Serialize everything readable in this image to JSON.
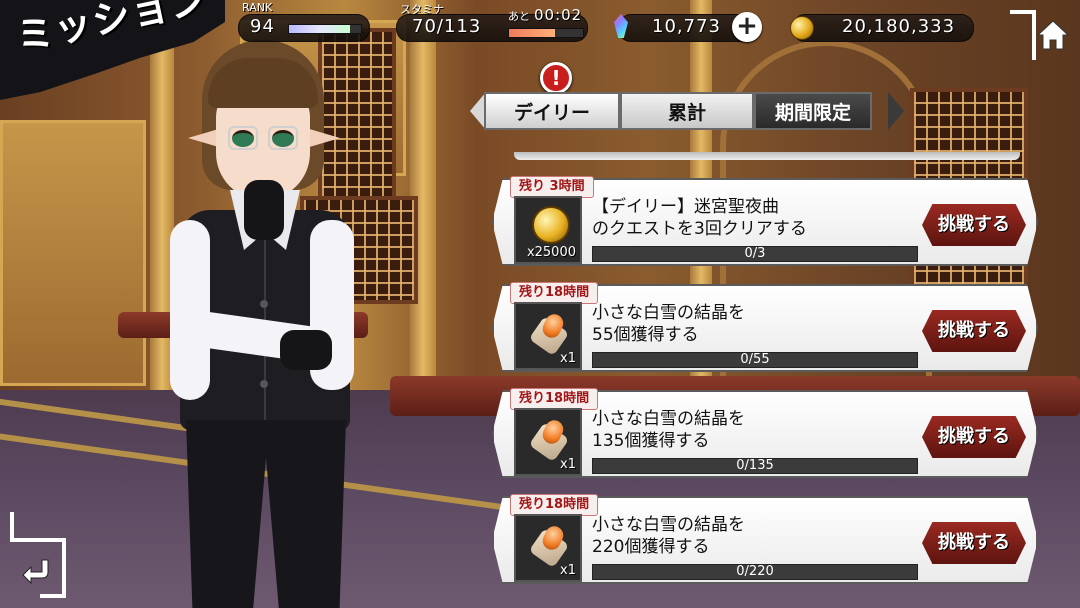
{
  "screen": {
    "title": "ミッション"
  },
  "status": {
    "rank_label": "RANK",
    "rank_value": "94",
    "rank_progress": 0.85,
    "stamina_label": "スタミナ",
    "stamina_value": "70/113",
    "stamina_progress": 0.62,
    "timer_label": "あと",
    "timer_value": "00:02",
    "crystals": "10,773",
    "gold": "20,180,333",
    "plus_label": "+"
  },
  "icons": {
    "crystal": "crystal-icon",
    "coin": "coin-icon",
    "home": "home-icon",
    "back": "back-icon",
    "alert": "alert-icon"
  },
  "alert_mark": "!",
  "tabs": [
    {
      "label": "デイリー"
    },
    {
      "label": "累計"
    },
    {
      "label": "期間限定"
    }
  ],
  "missions": [
    {
      "time_left": "残り 3時間",
      "text_line1": "【デイリー】迷宮聖夜曲",
      "text_line2": "のクエストを3回クリアする",
      "reward_type": "coin",
      "quantity": "x25000",
      "progress_text": "0/3",
      "progress": 0,
      "button_label": "挑戦する"
    },
    {
      "time_left": "残り18時間",
      "text_line1": "小さな白雪の結晶を",
      "text_line2": "55個獲得する",
      "reward_type": "crystal",
      "quantity": "x1",
      "progress_text": "0/55",
      "progress": 0,
      "button_label": "挑戦する"
    },
    {
      "time_left": "残り18時間",
      "text_line1": "小さな白雪の結晶を",
      "text_line2": "135個獲得する",
      "reward_type": "crystal",
      "quantity": "x1",
      "progress_text": "0/135",
      "progress": 0,
      "button_label": "挑戦する"
    },
    {
      "time_left": "残り18時間",
      "text_line1": "小さな白雪の結晶を",
      "text_line2": "220個獲得する",
      "reward_type": "crystal",
      "quantity": "x1",
      "progress_text": "0/220",
      "progress": 0,
      "button_label": "挑戦する"
    }
  ]
}
